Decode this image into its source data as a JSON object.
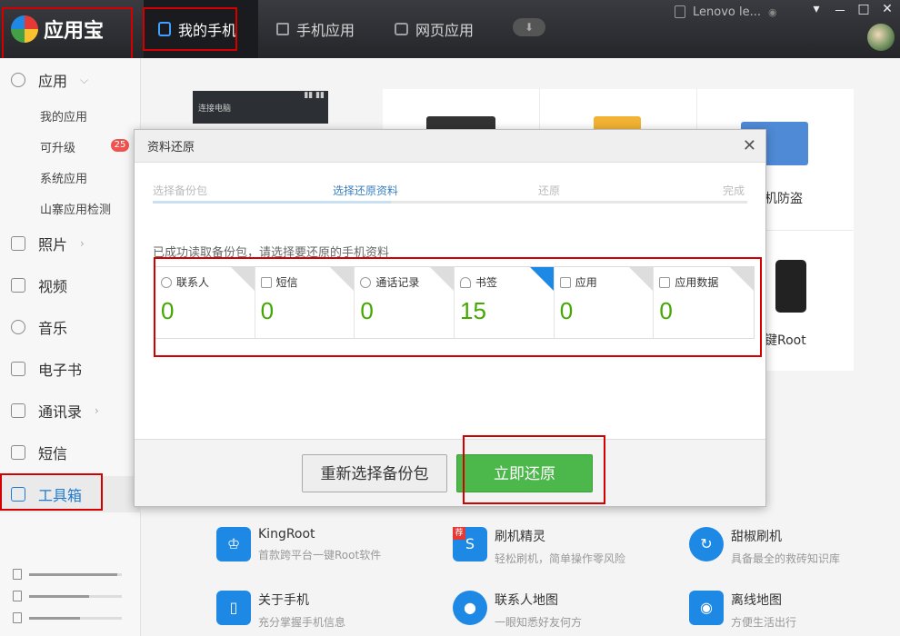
{
  "app": {
    "name": "应用宝"
  },
  "nav": {
    "tabs": [
      {
        "label": "我的手机",
        "icon": "phone-icon"
      },
      {
        "label": "手机应用",
        "icon": "bag-icon"
      },
      {
        "label": "网页应用",
        "icon": "web-icon"
      }
    ],
    "download_icon": "download-icon"
  },
  "device": {
    "name": "Lenovo le..."
  },
  "window_controls": [
    "▾",
    "－",
    "□",
    "✕"
  ],
  "sidebar": {
    "apps_label": "应用",
    "sub_items": [
      "我的应用",
      "可升级",
      "系统应用",
      "山寨应用检测"
    ],
    "upgrade_badge": "25",
    "items": [
      "照片",
      "视频",
      "音乐",
      "电子书",
      "通讯录",
      "短信",
      "工具箱"
    ]
  },
  "storage": {
    "bars": [
      0.95,
      0.65,
      0.55
    ]
  },
  "tiles": {
    "labels": [
      "机防盗",
      "键Root"
    ]
  },
  "phone_strip": {
    "label": "连接电脑"
  },
  "tools": [
    {
      "title": "KingRoot",
      "desc": "首款跨平台一键Root软件"
    },
    {
      "title": "刷机精灵",
      "desc": "轻松刷机，简单操作零风险",
      "tag": "荐"
    },
    {
      "title": "甜椒刷机",
      "desc": "具备最全的救砖知识库"
    },
    {
      "title": "关于手机",
      "desc": "充分掌握手机信息"
    },
    {
      "title": "联系人地图",
      "desc": "一眼知悉好友何方"
    },
    {
      "title": "离线地图",
      "desc": "方便生活出行"
    }
  ],
  "dialog": {
    "title": "资料还原",
    "close": "✕",
    "steps": [
      "选择备份包",
      "选择还原资料",
      "还原",
      "完成"
    ],
    "active_step": 1,
    "message": "已成功读取备份包，请选择要还原的手机资料",
    "categories": [
      {
        "label": "联系人",
        "count": "0",
        "checked": false
      },
      {
        "label": "短信",
        "count": "0",
        "checked": false
      },
      {
        "label": "通话记录",
        "count": "0",
        "checked": false
      },
      {
        "label": "书签",
        "count": "15",
        "checked": true
      },
      {
        "label": "应用",
        "count": "0",
        "checked": false
      },
      {
        "label": "应用数据",
        "count": "0",
        "checked": false
      }
    ],
    "btn_reselect": "重新选择备份包",
    "btn_restore": "立即还原"
  }
}
